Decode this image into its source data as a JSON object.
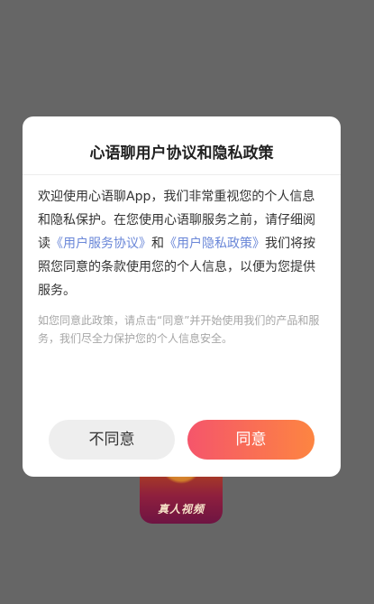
{
  "app_icon": {
    "label": "真人视频"
  },
  "dialog": {
    "title": "心语聊用户协议和隐私政策",
    "body_part1": "欢迎使用心语聊App，我们非常重视您的个人信息和隐私保护。在您使用心语聊服务之前，请仔细阅读",
    "user_agreement_link": "《用户服务协议》",
    "and_text": "和",
    "privacy_policy_link": "《用户隐私政策》",
    "body_part2": "我们将按照您同意的条款使用您的个人信息，以便为您提供服务。",
    "note": "如您同意此政策，请点击“同意”并开始使用我们的产品和服务，我们尽全力保护您的个人信息安全。",
    "disagree_label": "不同意",
    "agree_label": "同意"
  },
  "colors": {
    "backdrop": "#666666",
    "link": "#6a87d8",
    "agree_gradient_start": "#f5556b",
    "agree_gradient_end": "#fd8541"
  }
}
